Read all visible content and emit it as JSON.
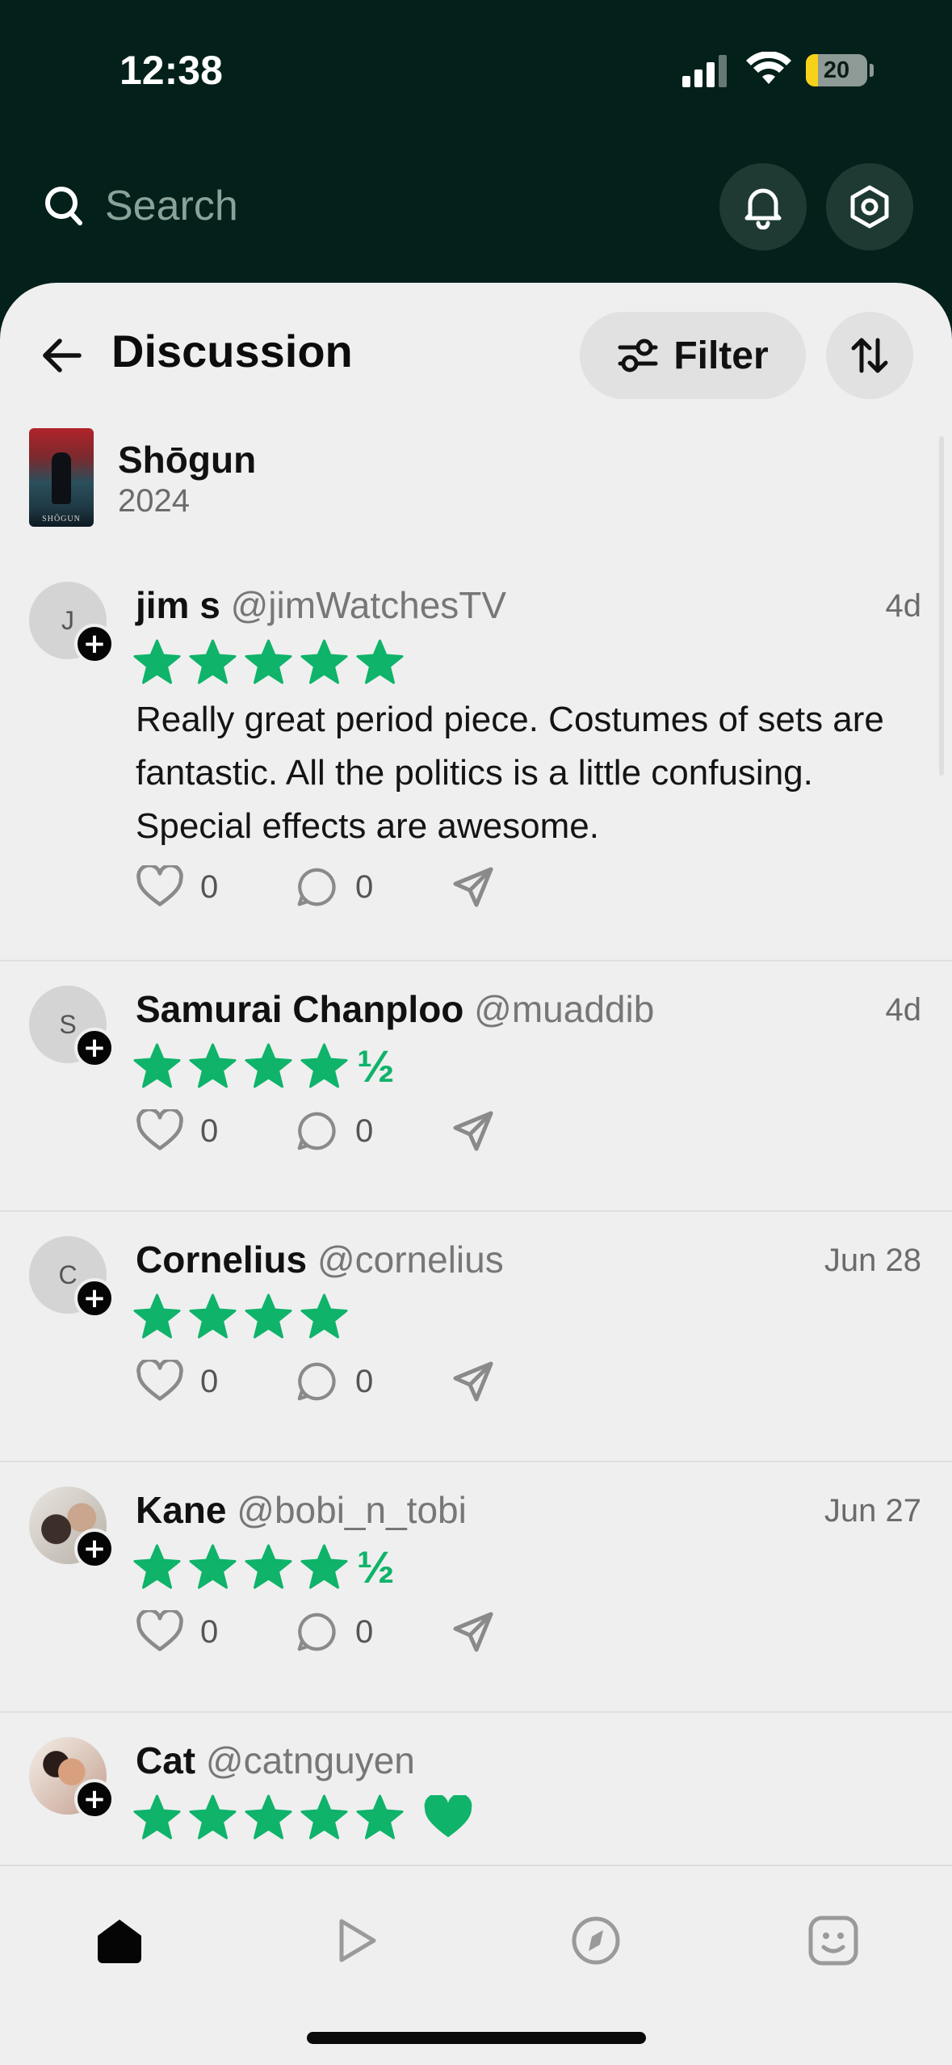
{
  "status_bar": {
    "time": "12:38",
    "battery": "20",
    "battery_level_percent": 20
  },
  "search": {
    "placeholder": "Search"
  },
  "header": {
    "title": "Discussion",
    "filter_label": "Filter"
  },
  "show": {
    "title": "Shōgun",
    "year": "2024",
    "poster_text": "SHŌGUN"
  },
  "colors": {
    "brand_dark": "#03201a",
    "star_green": "#0fb36a",
    "sheet_bg": "#efefef"
  },
  "posts": [
    {
      "avatar_initial": "J",
      "display_name": "jim s",
      "handle": "@jimWatchesTV",
      "date": "4d",
      "rating_stars": 5,
      "rating_half": "",
      "text": "Really great period piece. Costumes of sets are fantastic. All the politics is a little confusing. Special effects are awesome.",
      "likes": "0",
      "comments": "0"
    },
    {
      "avatar_initial": "S",
      "display_name": "Samurai Chanploo",
      "handle": "@muaddib",
      "date": "4d",
      "rating_stars": 4,
      "rating_half": "½",
      "text": "",
      "likes": "0",
      "comments": "0"
    },
    {
      "avatar_initial": "C",
      "display_name": "Cornelius",
      "handle": "@cornelius",
      "date": "Jun 28",
      "rating_stars": 4,
      "rating_half": "",
      "text": "",
      "likes": "0",
      "comments": "0"
    },
    {
      "avatar_initial": "",
      "display_name": "Kane",
      "handle": "@bobi_n_tobi",
      "date": "Jun 27",
      "rating_stars": 4,
      "rating_half": "½",
      "text": "",
      "likes": "0",
      "comments": "0"
    },
    {
      "avatar_initial": "",
      "display_name": "Cat",
      "handle": "@catnguyen",
      "date": "",
      "rating_stars": 5,
      "rating_half": "",
      "liked_heart": true,
      "text": "",
      "likes": "",
      "comments": ""
    }
  ],
  "tabs": [
    {
      "icon": "home-icon",
      "active": true
    },
    {
      "icon": "play-icon",
      "active": false
    },
    {
      "icon": "compass-icon",
      "active": false
    },
    {
      "icon": "face-icon",
      "active": false
    }
  ]
}
